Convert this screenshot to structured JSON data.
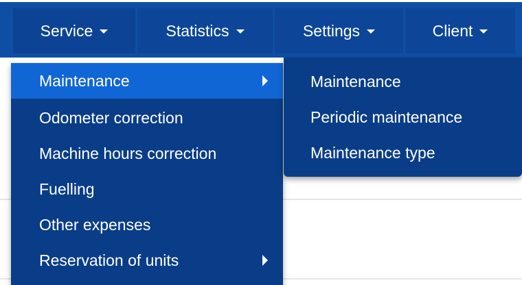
{
  "nav": {
    "items": [
      {
        "label": "Service"
      },
      {
        "label": "Statistics"
      },
      {
        "label": "Settings"
      },
      {
        "label": "Client"
      }
    ]
  },
  "service_menu": {
    "items": [
      {
        "label": "Maintenance",
        "has_submenu": true,
        "active": true
      },
      {
        "label": "Odometer correction"
      },
      {
        "label": "Machine hours correction"
      },
      {
        "label": "Fuelling"
      },
      {
        "label": "Other expenses"
      },
      {
        "label": "Reservation of units",
        "has_submenu": true
      }
    ]
  },
  "maintenance_submenu": {
    "items": [
      {
        "label": "Maintenance"
      },
      {
        "label": "Periodic maintenance"
      },
      {
        "label": "Maintenance type"
      }
    ]
  },
  "colors": {
    "navbar": "#0f4ea5",
    "menu": "#0a3d87",
    "active_item": "#1166d6",
    "text": "#ffffff"
  }
}
